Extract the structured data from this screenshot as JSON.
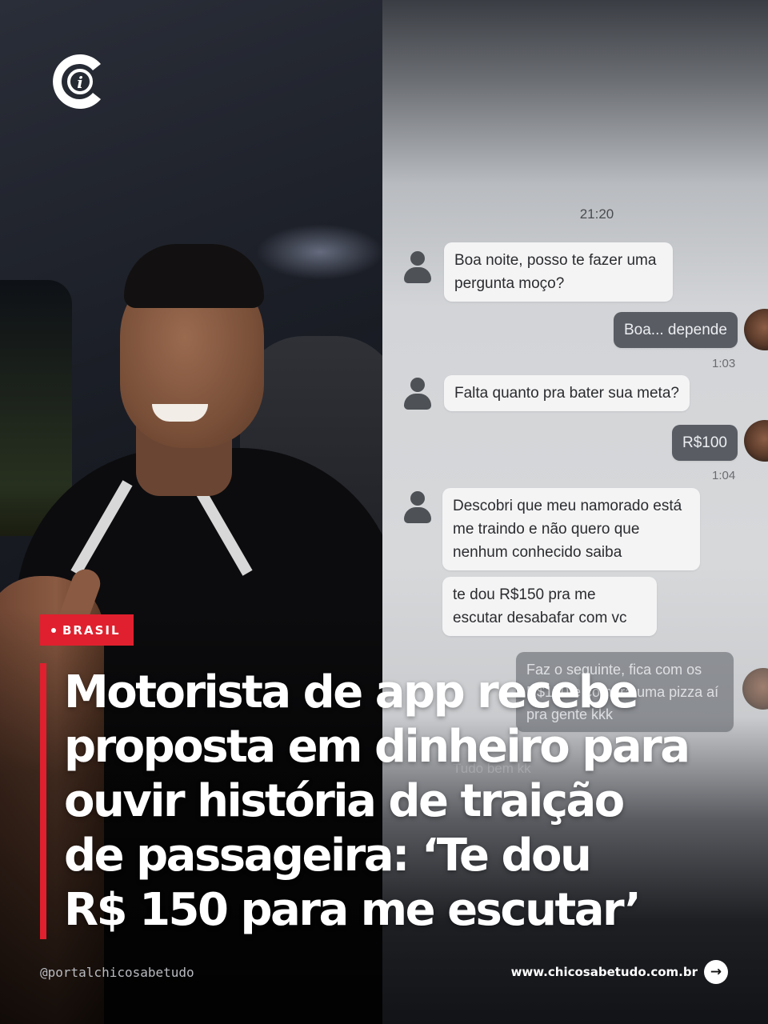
{
  "brand": {
    "logo_icon": "chico-sabe-tudo-logo-icon",
    "accent_color": "#e0202e"
  },
  "chat": {
    "time_header": "21:20",
    "messages": [
      {
        "from": "passenger",
        "text": "Boa noite, posso te fazer uma pergunta moço?"
      },
      {
        "from": "driver",
        "text": "Boa... depende",
        "timestamp": "1:03"
      },
      {
        "from": "passenger",
        "text": "Falta quanto pra bater sua meta?"
      },
      {
        "from": "driver",
        "text": "R$100",
        "timestamp": "1:04"
      },
      {
        "from": "passenger",
        "text": "Descobri que meu namorado está me traindo e não quero que nenhum conhecido saiba"
      },
      {
        "from": "passenger",
        "text": "te dou R$150 pra me escutar desabafar com vc"
      },
      {
        "from": "driver",
        "text": "Faz o seguinte, fica com os R$150 e compra uma pizza aí pra gente kkk"
      },
      {
        "from": "passenger",
        "text": "Tudo bem kk"
      }
    ]
  },
  "article": {
    "category": "BRASIL",
    "headline_lines": [
      "Motorista de app recebe",
      "proposta em dinheiro para",
      "ouvir história de traição",
      "de passageira: ‘Te dou",
      "R$ 150 para me escutar’"
    ]
  },
  "footer": {
    "handle": "@portalchicosabetudo",
    "website": "www.chicosabetudo.com.br",
    "arrow_icon": "→"
  }
}
